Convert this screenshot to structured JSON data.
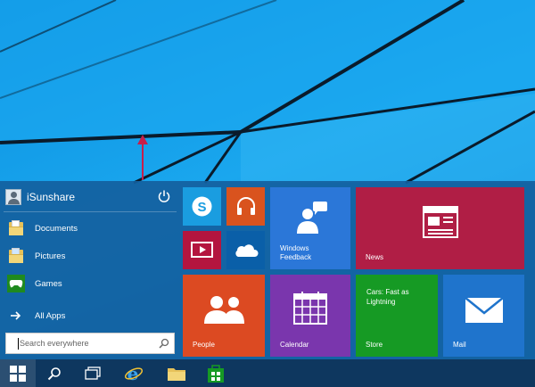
{
  "user": {
    "name": "iSunshare"
  },
  "places": [
    {
      "label": "Documents"
    },
    {
      "label": "Pictures"
    },
    {
      "label": "Games"
    }
  ],
  "all_apps": {
    "label": "All Apps"
  },
  "search": {
    "placeholder": "Search everywhere"
  },
  "tiles": {
    "windows_feedback": "Windows Feedback",
    "news": "News",
    "people": "People",
    "calendar": "Calendar",
    "cars_caption": "Cars: Fast as Lightning",
    "store": "Store",
    "mail": "Mail"
  },
  "colors": {
    "skype": "#1a9de0",
    "music": "#d9531e",
    "video": "#b4153f",
    "onedrive": "#0a5fa8",
    "feedback": "#2b77d8",
    "news": "#b01e45",
    "people": "#dc4a22",
    "calendar": "#7a36ad",
    "store": "#169a24",
    "mail": "#1f74cc"
  },
  "icons": [
    "user-avatar-icon",
    "power-icon",
    "documents-folder-icon",
    "pictures-folder-icon",
    "games-icon",
    "arrow-right-icon",
    "search-icon",
    "skype-icon",
    "music-headphones-icon",
    "video-icon",
    "onedrive-cloud-icon",
    "feedback-person-icon",
    "news-icon",
    "people-icon",
    "calendar-icon",
    "mail-icon",
    "windows-logo-icon",
    "task-view-icon",
    "internet-explorer-icon",
    "file-explorer-icon",
    "store-icon"
  ]
}
